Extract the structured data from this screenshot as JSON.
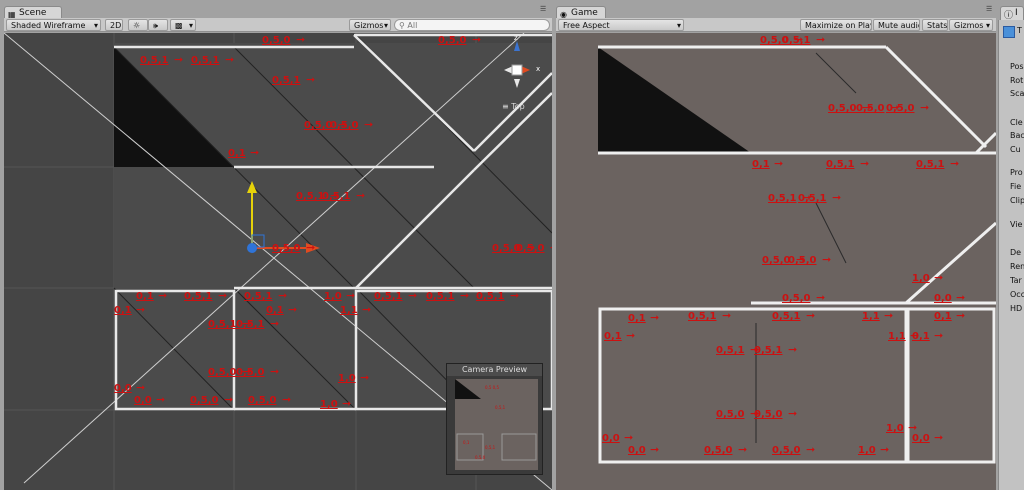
{
  "scene": {
    "tab_label": "Scene",
    "shading_mode": "Shaded Wireframe",
    "mode_2d": "2D",
    "gizmos_label": "Gizmos",
    "search_placeholder": "All",
    "orientation_label": "Top",
    "gizmo_axis_z": "z",
    "gizmo_axis_x": "x",
    "camera_preview_label": "Camera Preview",
    "labels": [
      "0,5,0",
      "0,5,0",
      "0,5,1",
      "0,5,1",
      "0,5,1",
      "0,5,0",
      "0,5,0",
      "0,1",
      "0,5,1",
      "0,5,1",
      "0,5,0",
      "0,5,0",
      "0,5,0",
      "0,1",
      "0,5,1",
      "0,5,1",
      "1,0",
      "0,5,1",
      "0,1",
      "0,5,1",
      "0,5,1",
      "1,1",
      "0,1",
      "0,5,1",
      "0,5,1",
      "0,5,0",
      "0,5,0",
      "1,0",
      "0,0",
      "0,0",
      "0,5,0",
      "0,5,0",
      "1,0"
    ]
  },
  "game": {
    "tab_label": "Game",
    "aspect": "Free Aspect",
    "maximize_label": "Maximize on Play",
    "mute_label": "Mute audio",
    "stats_label": "Stats",
    "gizmos_label": "Gizmos",
    "labels": [
      "0,5,0",
      "0,5,1",
      "0,5,0",
      "0,5,0",
      "0,5,0",
      "0,1",
      "0,5,1",
      "0,5,1",
      "0,5,1",
      "0,5,1",
      "0,5,0",
      "0,5,0",
      "0,5,0",
      "1,0",
      "0,0",
      "0,1",
      "0,5,1",
      "0,5,1",
      "1,1",
      "0,1",
      "1,1",
      "0,1",
      "0,1",
      "0,5,1",
      "0,5,1",
      "0,5,0",
      "0,5,0",
      "1,0",
      "0,0",
      "0,0",
      "0,0",
      "0,5,0",
      "0,5,0",
      "1,0"
    ]
  },
  "inspector": {
    "tab_label": "I",
    "rows": [
      "Pos",
      "Rot",
      "Sca",
      "Cle",
      "Bac",
      "Cu",
      "Pro",
      "Fie",
      "Clip",
      "Vie",
      "De",
      "Ren",
      "Tar",
      "Occ",
      "HD"
    ],
    "header_label": "T"
  },
  "colors": {
    "label_red": "#cc1111",
    "scene_bg": "#444444",
    "game_bg": "#6b6360"
  }
}
